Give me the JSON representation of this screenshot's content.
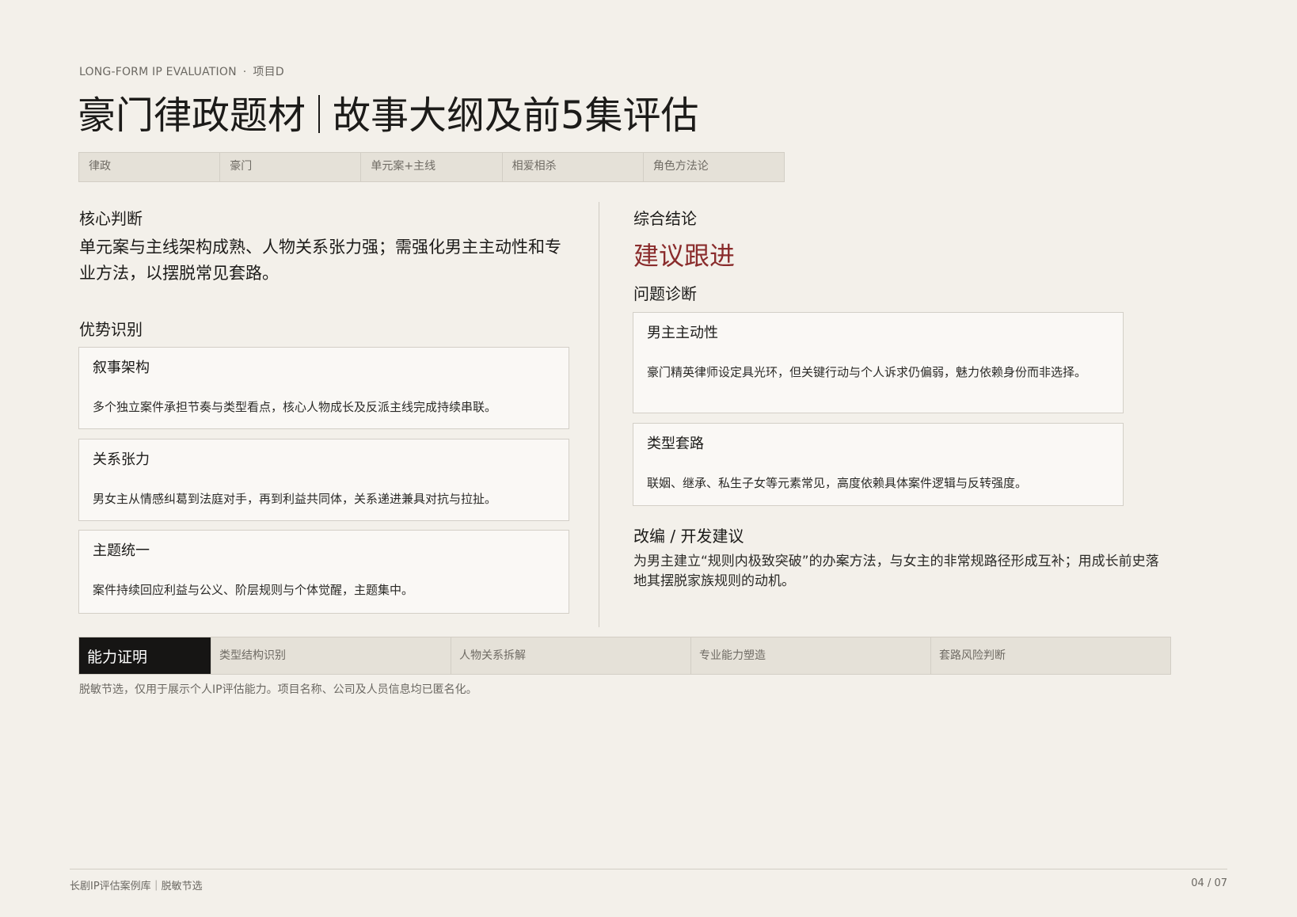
{
  "header": {
    "kicker_en": "LONG-FORM IP EVALUATION",
    "kicker_sep": "·",
    "kicker_project": "项目D",
    "title_left": "豪门律政题材",
    "title_right": "故事大纲及前5集评估"
  },
  "tags": [
    "律政",
    "豪门",
    "单元案+主线",
    "相爱相杀",
    "角色方法论"
  ],
  "left": {
    "core_heading": "核心判断",
    "core_text": "单元案与主线架构成熟、人物关系张力强；需强化男主主动性和专业方法，以摆脱常见套路。",
    "strengths_heading": "优势识别",
    "strengths": [
      {
        "title": "叙事架构",
        "body": "多个独立案件承担节奏与类型看点，核心人物成长及反派主线完成持续串联。"
      },
      {
        "title": "关系张力",
        "body": "男女主从情感纠葛到法庭对手，再到利益共同体，关系递进兼具对抗与拉扯。"
      },
      {
        "title": "主题统一",
        "body": "案件持续回应利益与公义、阶层规则与个体觉醒，主题集中。"
      }
    ]
  },
  "right": {
    "conclusion_heading": "综合结论",
    "verdict": "建议跟进",
    "diagnosis_heading": "问题诊断",
    "issues": [
      {
        "title": "男主主动性",
        "body": "豪门精英律师设定具光环，但关键行动与个人诉求仍偏弱，魅力依赖身份而非选择。"
      },
      {
        "title": "类型套路",
        "body": "联姻、继承、私生子女等元素常见，高度依赖具体案件逻辑与反转强度。"
      }
    ],
    "advice_heading": "改编 / 开发建议",
    "advice_text": "为男主建立“规则内极致突破”的办案方法，与女主的非常规路径形成互补；用成长前史落地其摆脱家族规则的动机。"
  },
  "abilities": {
    "label": "能力证明",
    "items": [
      "类型结构识别",
      "人物关系拆解",
      "专业能力塑造",
      "套路风险判断"
    ]
  },
  "note": "脱敏节选，仅用于展示个人IP评估能力。项目名称、公司及人员信息均已匿名化。",
  "footer": {
    "left": "长剧IP评估案例库｜脱敏节选",
    "page": "04 / 07"
  }
}
